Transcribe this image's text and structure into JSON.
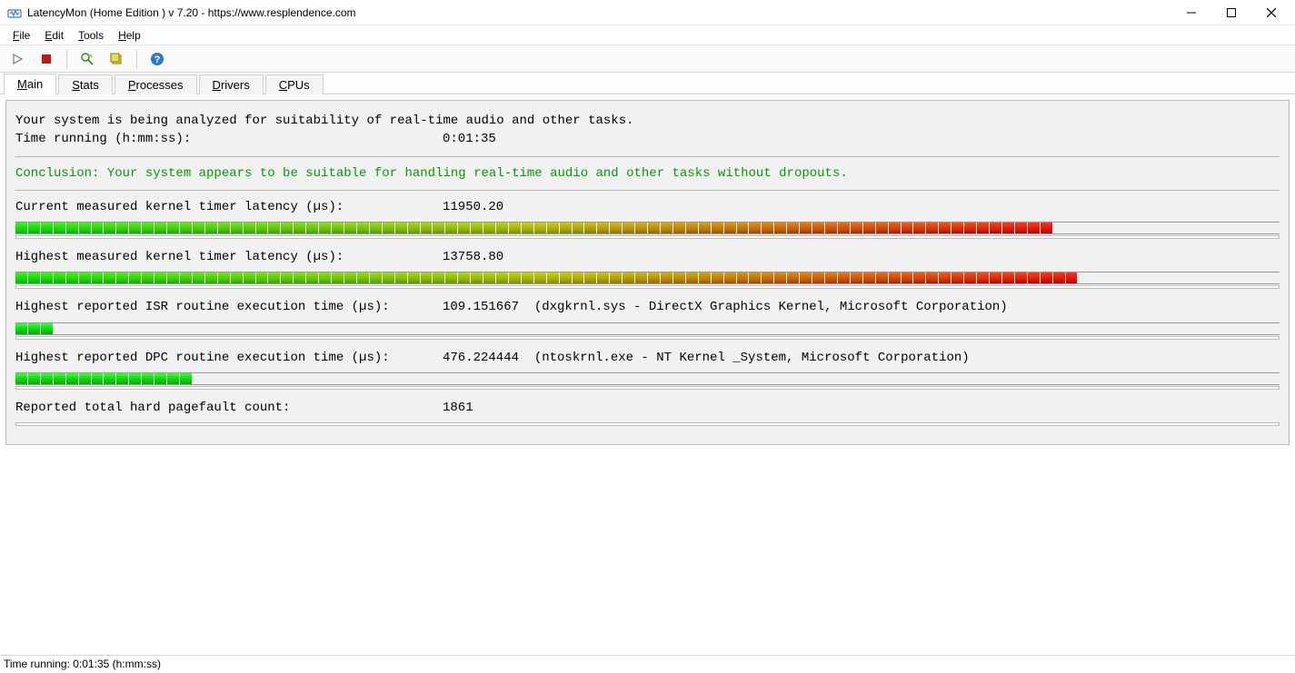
{
  "window": {
    "title": "LatencyMon  (Home Edition )  v 7.20 - https://www.resplendence.com"
  },
  "menu": {
    "file": "File",
    "edit": "Edit",
    "tools": "Tools",
    "help": "Help"
  },
  "tabs": {
    "main": "Main",
    "stats": "Stats",
    "processes": "Processes",
    "drivers": "Drivers",
    "cpus": "CPUs"
  },
  "main": {
    "analyze_line": "Your system is being analyzed for suitability of real-time audio and other tasks.",
    "time_label": "Time running (h:mm:ss):",
    "time_value": "0:01:35",
    "conclusion": "Conclusion: Your system appears to be suitable for handling real-time audio and other tasks without dropouts.",
    "metrics": [
      {
        "label": "Current measured kernel timer latency (µs):",
        "value": "11950.20",
        "detail": "",
        "fill": 82,
        "gradient": true
      },
      {
        "label": "Highest measured kernel timer latency (µs):",
        "value": "13758.80",
        "detail": "",
        "fill": 84,
        "gradient": true
      },
      {
        "label": "Highest reported ISR routine execution time (µs):",
        "value": "109.151667",
        "detail": "(dxgkrnl.sys - DirectX Graphics Kernel, Microsoft Corporation)",
        "fill": 3,
        "gradient": false
      },
      {
        "label": "Highest reported DPC routine execution time (µs):",
        "value": "476.224444",
        "detail": "(ntoskrnl.exe - NT Kernel _System, Microsoft Corporation)",
        "fill": 14,
        "gradient": false
      },
      {
        "label": "Reported total hard pagefault count:",
        "value": "1861",
        "detail": "",
        "fill": 0,
        "gradient": false,
        "nobar": true
      }
    ]
  },
  "status": {
    "text": "Time running: 0:01:35  (h:mm:ss)"
  }
}
